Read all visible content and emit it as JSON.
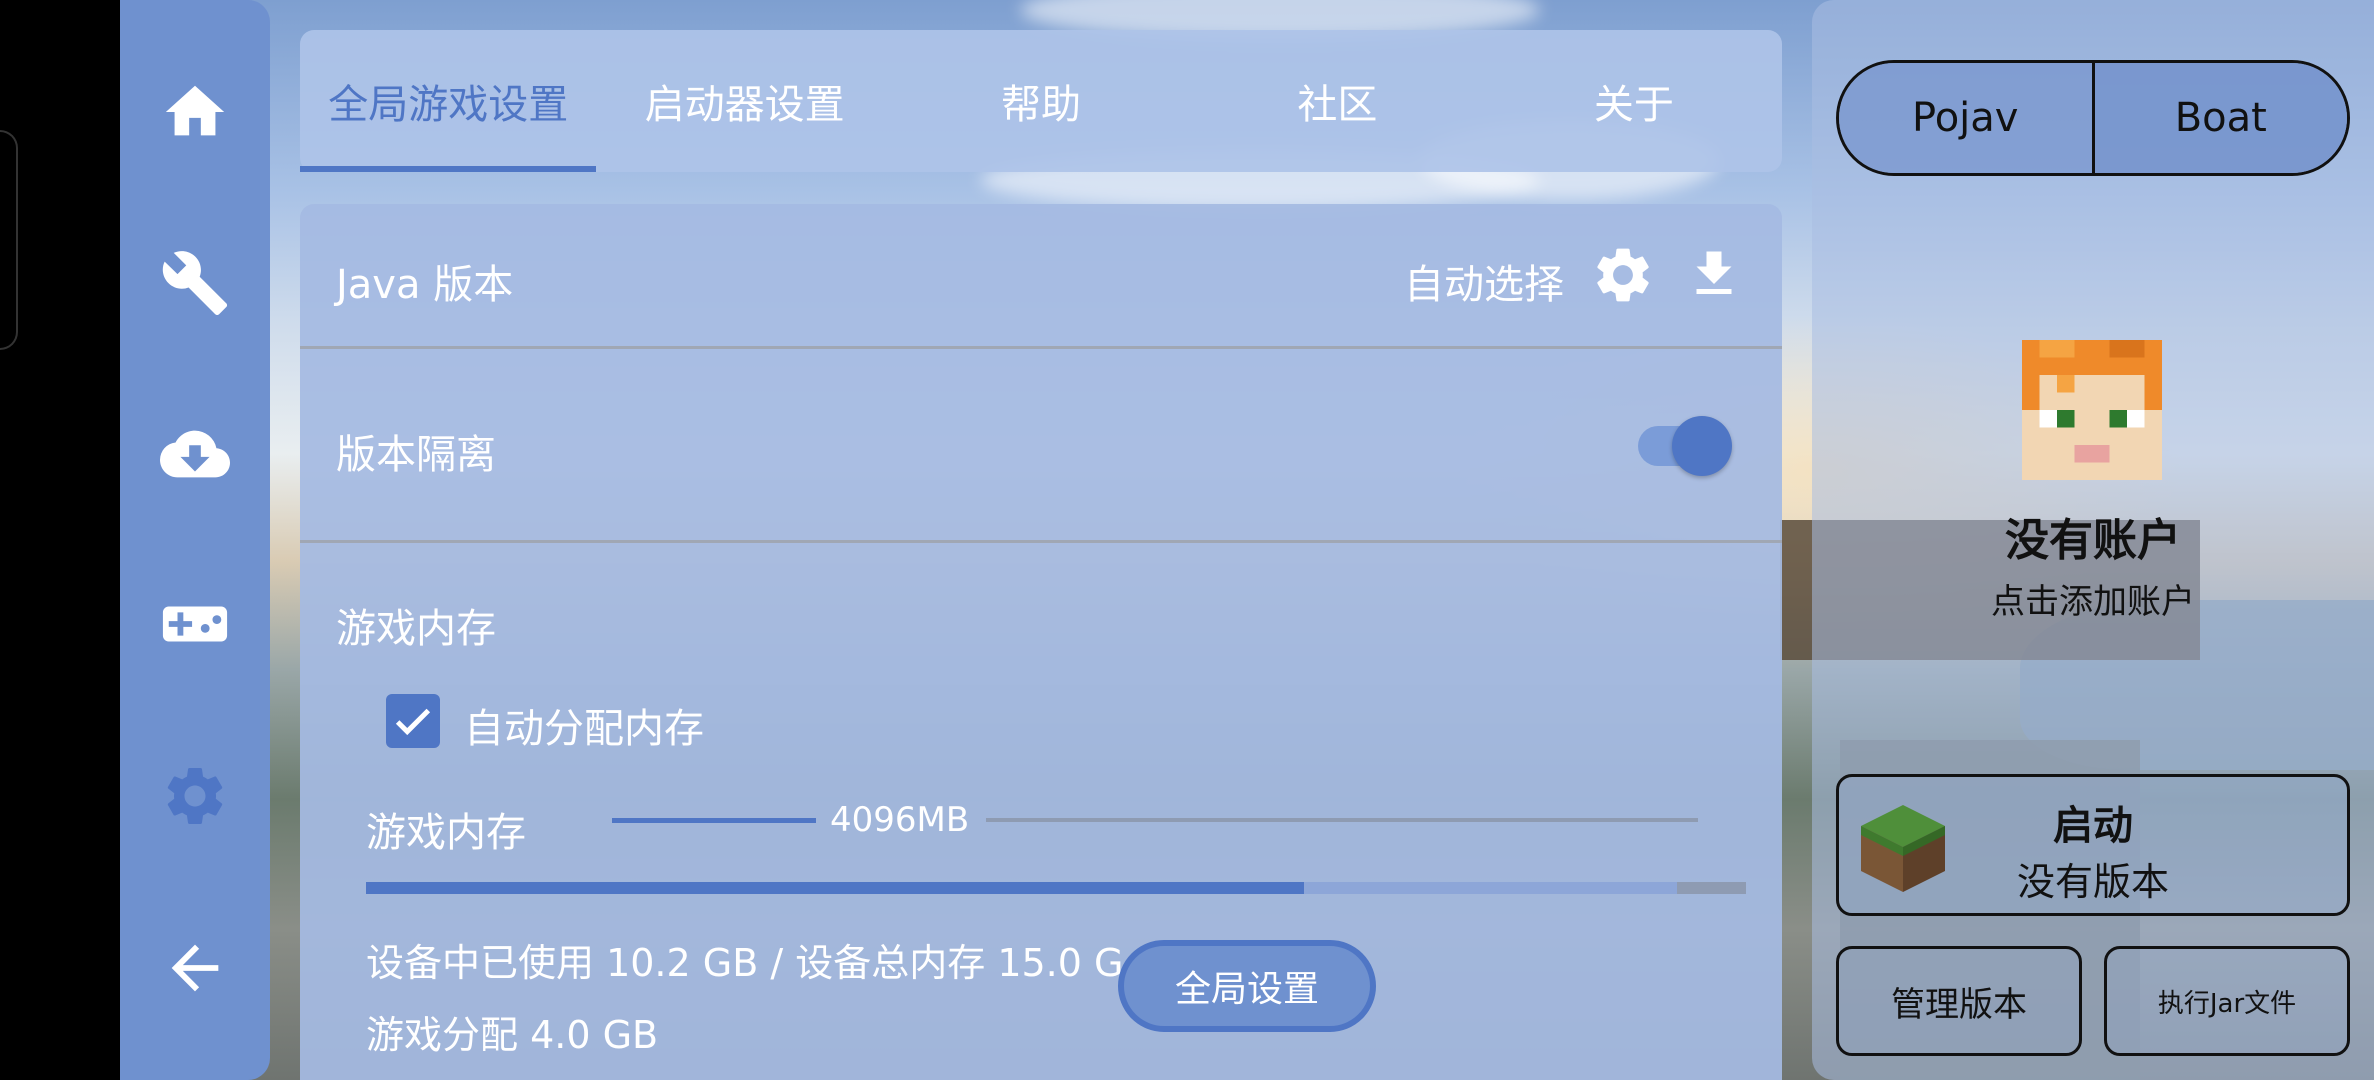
{
  "nav": {
    "items": [
      {
        "icon": "home-icon"
      },
      {
        "icon": "wrench-icon"
      },
      {
        "icon": "cloud-download-icon"
      },
      {
        "icon": "gamepad-icon"
      },
      {
        "icon": "gear-icon"
      },
      {
        "icon": "back-arrow-icon"
      }
    ]
  },
  "tabs": [
    {
      "label": "全局游戏设置",
      "active": true
    },
    {
      "label": "启动器设置",
      "active": false
    },
    {
      "label": "帮助",
      "active": false
    },
    {
      "label": "社区",
      "active": false
    },
    {
      "label": "关于",
      "active": false
    }
  ],
  "settings": {
    "java_version_label": "Java 版本",
    "java_version_value": "自动选择",
    "isolation_label": "版本隔离",
    "isolation_enabled": true,
    "memory_section_label": "游戏内存",
    "auto_memory_label": "自动分配内存",
    "auto_memory_checked": true,
    "memory_slider_label": "游戏内存",
    "memory_slider_value": "4096MB",
    "memory_slider_fraction": 0.26,
    "device_usage_text": "设备中已使用 10.2 GB / 设备总内存 15.0 G",
    "game_alloc_text": "游戏分配 4.0 GB",
    "memory_used_fraction": 0.68,
    "memory_allocated_fraction": 0.95
  },
  "global_settings_button": "全局设置",
  "right_panel": {
    "segments": [
      {
        "label": "Pojav",
        "selected": true
      },
      {
        "label": "Boat",
        "selected": false
      }
    ],
    "account_name": "没有账户",
    "account_hint": "点击添加账户",
    "launch_title": "启动",
    "launch_subtitle": "没有版本",
    "manage_versions": "管理版本",
    "run_jar": "执行Jar文件"
  },
  "colors": {
    "accent": "#4f76c5",
    "nav_bg": "#6f91cf",
    "panel_bg": "#a5bae2"
  }
}
